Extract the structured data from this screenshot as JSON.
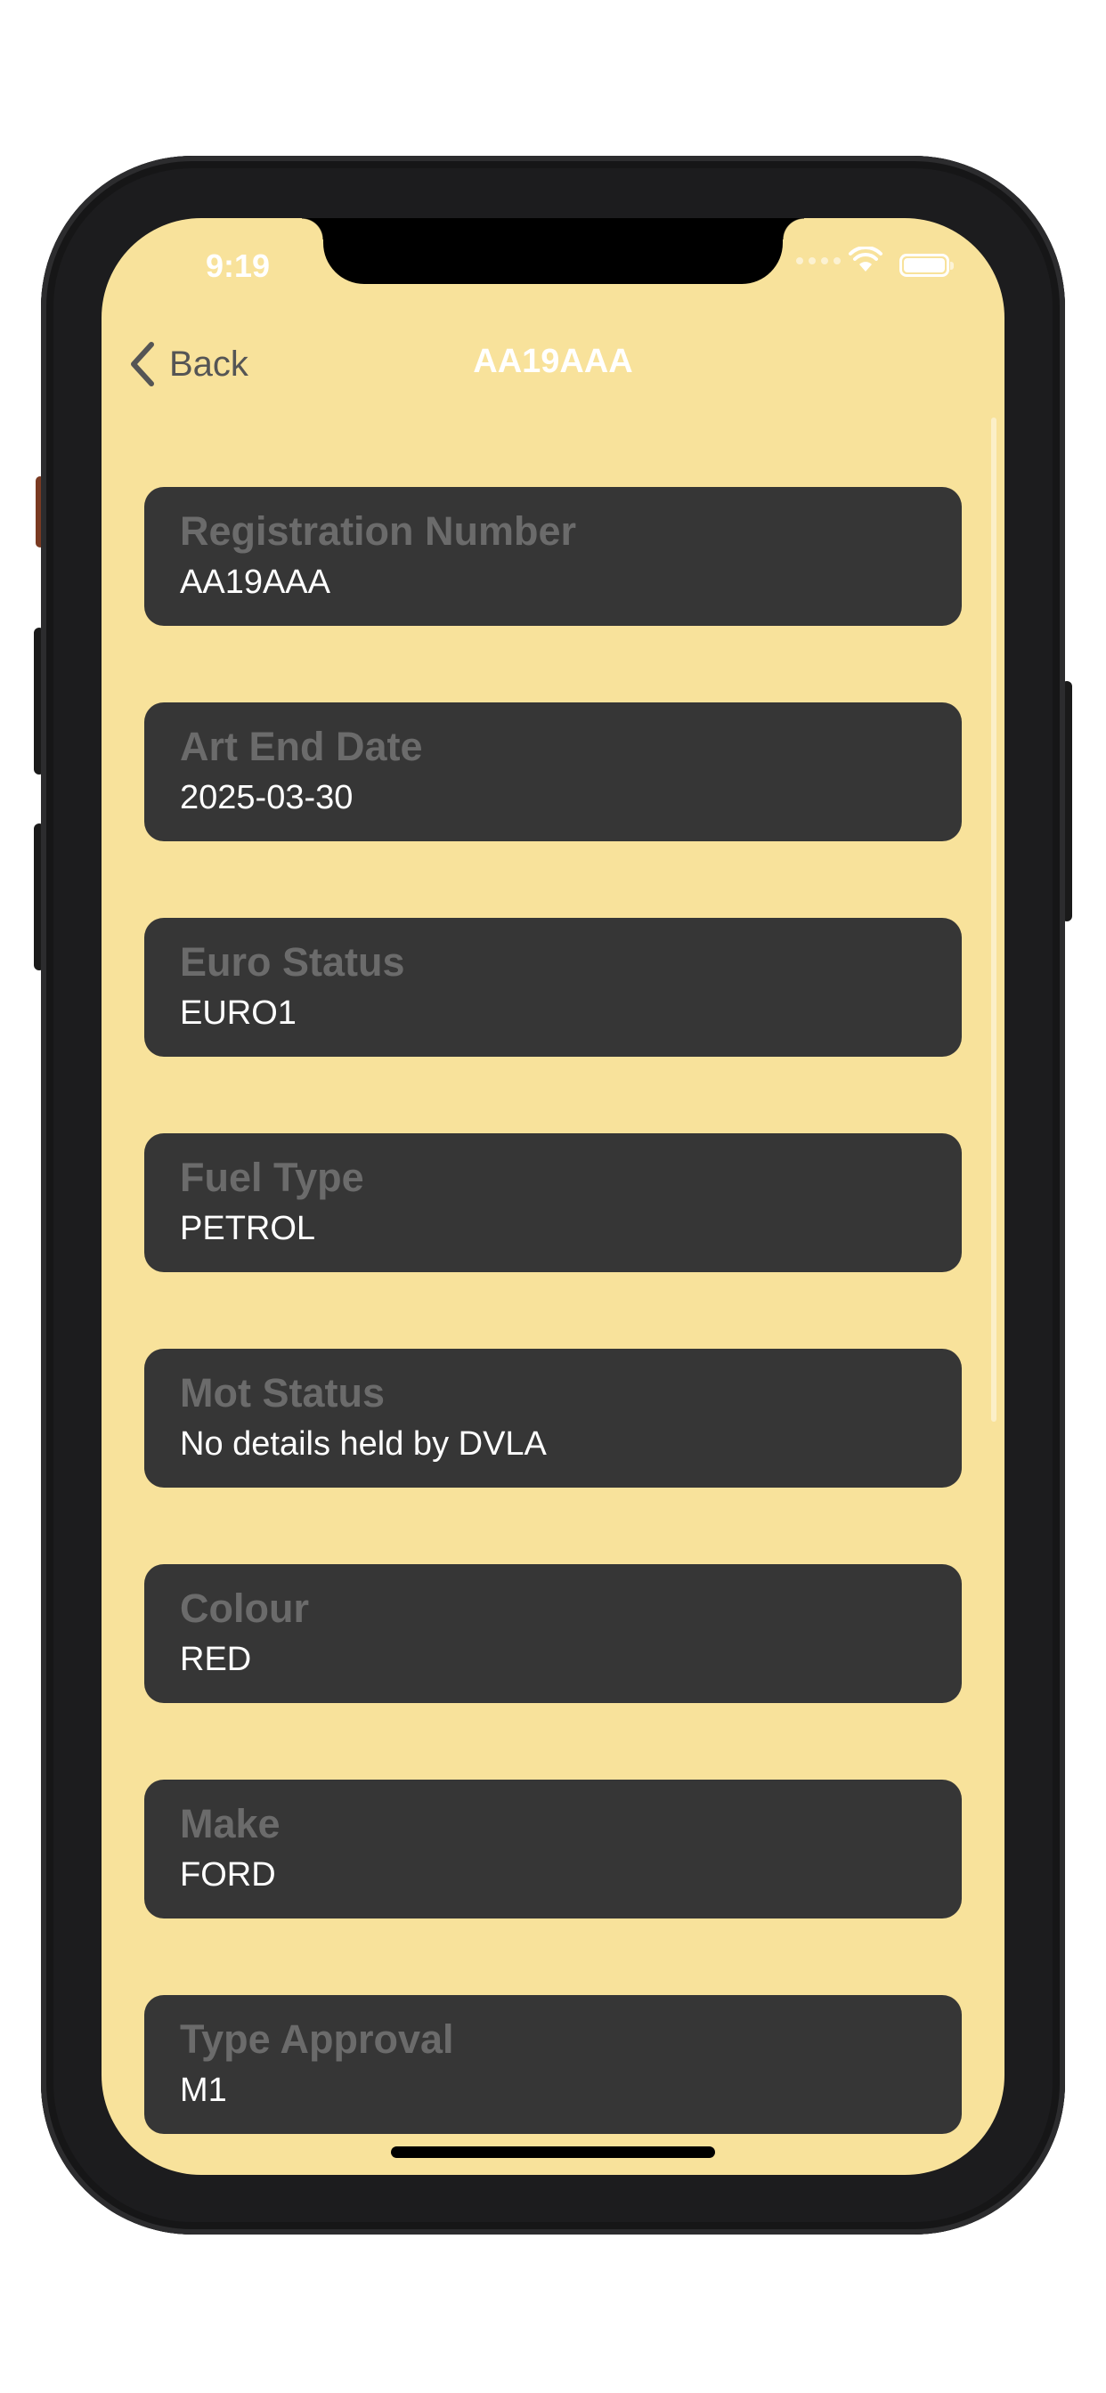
{
  "status_bar": {
    "time": "9:19",
    "icons": [
      "signal-dots-icon",
      "wifi-icon",
      "battery-icon"
    ]
  },
  "navbar": {
    "back_label": "Back",
    "back_icon": "chevron-left-icon",
    "title": "AA19AAA"
  },
  "details": [
    {
      "label": "Registration Number",
      "value": "AA19AAA"
    },
    {
      "label": "Art End Date",
      "value": "2025-03-30"
    },
    {
      "label": "Euro Status",
      "value": "EURO1"
    },
    {
      "label": "Fuel Type",
      "value": "PETROL"
    },
    {
      "label": "Mot Status",
      "value": "No details held by DVLA"
    },
    {
      "label": "Colour",
      "value": "RED"
    },
    {
      "label": "Make",
      "value": "FORD"
    },
    {
      "label": "Type Approval",
      "value": "M1"
    }
  ],
  "colors": {
    "screen_background": "#f8e29b",
    "card_background": "#363636",
    "card_label": "#6b6b6b",
    "card_value": "#ffffff",
    "back_button": "#555555",
    "nav_title": "#ffffff"
  }
}
